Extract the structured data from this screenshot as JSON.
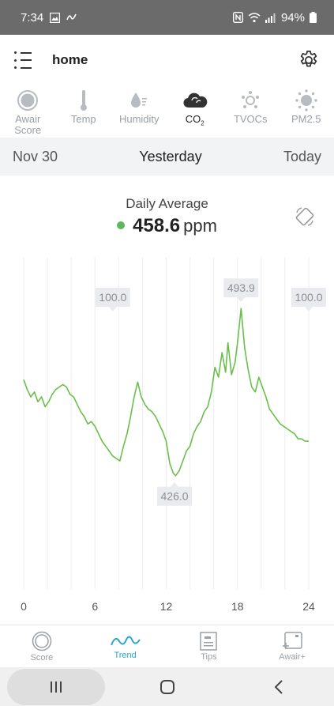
{
  "status_bar": {
    "time": "7:34",
    "battery": "94%"
  },
  "header": {
    "title": "home"
  },
  "sensor_tabs": [
    {
      "label": "Awair Score",
      "icon": "awair-score-icon",
      "active": false
    },
    {
      "label": "Temp",
      "icon": "thermometer-icon",
      "active": false
    },
    {
      "label": "Humidity",
      "icon": "humidity-icon",
      "active": false
    },
    {
      "label": "CO2",
      "icon": "cloud-icon",
      "active": true
    },
    {
      "label": "TVOCs",
      "icon": "tvoc-icon",
      "active": false
    },
    {
      "label": "PM2.5",
      "icon": "pm25-icon",
      "active": false
    }
  ],
  "date_nav": {
    "prev": "Nov 30",
    "current": "Yesterday",
    "next": "Today"
  },
  "summary": {
    "title": "Daily Average",
    "value": "458.6",
    "unit": "ppm",
    "status_color": "#5cb85c"
  },
  "chart_data": {
    "type": "line",
    "x_ticks": [
      "0",
      "6",
      "12",
      "18",
      "24"
    ],
    "xlim": [
      0,
      24
    ],
    "ylim": [
      380,
      510
    ],
    "line_color": "#6abf4b",
    "annotations": [
      {
        "label": "100.0",
        "x": 7.5,
        "y": 490,
        "kind": "marker-down"
      },
      {
        "label": "100.0",
        "x": 24,
        "y": 490,
        "kind": "marker-down"
      },
      {
        "label": "493.9",
        "x": 18.3,
        "y": 493.9,
        "kind": "max"
      },
      {
        "label": "426.0",
        "x": 12.7,
        "y": 426.0,
        "kind": "min"
      }
    ],
    "series": [
      {
        "values": [
          [
            0.0,
            465
          ],
          [
            0.3,
            461
          ],
          [
            0.6,
            458
          ],
          [
            0.9,
            460
          ],
          [
            1.2,
            456
          ],
          [
            1.5,
            458
          ],
          [
            1.8,
            454
          ],
          [
            2.1,
            456
          ],
          [
            2.4,
            459
          ],
          [
            2.7,
            461
          ],
          [
            3.0,
            462
          ],
          [
            3.3,
            463
          ],
          [
            3.6,
            462
          ],
          [
            3.9,
            459
          ],
          [
            4.2,
            458
          ],
          [
            4.5,
            455
          ],
          [
            4.8,
            452
          ],
          [
            5.1,
            450
          ],
          [
            5.4,
            447
          ],
          [
            5.7,
            448
          ],
          [
            6.0,
            446
          ],
          [
            6.3,
            443
          ],
          [
            6.6,
            440
          ],
          [
            6.9,
            438
          ],
          [
            7.2,
            436
          ],
          [
            7.5,
            434
          ],
          [
            7.8,
            433
          ],
          [
            8.1,
            432
          ],
          [
            8.4,
            438
          ],
          [
            8.7,
            443
          ],
          [
            9.0,
            450
          ],
          [
            9.3,
            458
          ],
          [
            9.6,
            464
          ],
          [
            9.9,
            458
          ],
          [
            10.2,
            455
          ],
          [
            10.5,
            453
          ],
          [
            10.8,
            452
          ],
          [
            11.1,
            450
          ],
          [
            11.4,
            447
          ],
          [
            11.7,
            444
          ],
          [
            12.0,
            440
          ],
          [
            12.3,
            431
          ],
          [
            12.6,
            427
          ],
          [
            12.8,
            426
          ],
          [
            13.1,
            428
          ],
          [
            13.4,
            432
          ],
          [
            13.7,
            436
          ],
          [
            14.0,
            438
          ],
          [
            14.3,
            443
          ],
          [
            14.6,
            446
          ],
          [
            14.9,
            448
          ],
          [
            15.2,
            452
          ],
          [
            15.5,
            454
          ],
          [
            15.8,
            460
          ],
          [
            16.1,
            470
          ],
          [
            16.4,
            466
          ],
          [
            16.7,
            476
          ],
          [
            17.0,
            468
          ],
          [
            17.2,
            480
          ],
          [
            17.5,
            467
          ],
          [
            17.8,
            472
          ],
          [
            18.0,
            480
          ],
          [
            18.3,
            493.9
          ],
          [
            18.6,
            478
          ],
          [
            18.9,
            469
          ],
          [
            19.2,
            462
          ],
          [
            19.5,
            460
          ],
          [
            19.8,
            466
          ],
          [
            20.1,
            462
          ],
          [
            20.4,
            458
          ],
          [
            20.7,
            453
          ],
          [
            21.0,
            451
          ],
          [
            21.3,
            449
          ],
          [
            21.6,
            447
          ],
          [
            21.9,
            446
          ],
          [
            22.2,
            445
          ],
          [
            22.5,
            444
          ],
          [
            22.8,
            443
          ],
          [
            23.1,
            441
          ],
          [
            23.4,
            441
          ],
          [
            23.7,
            440
          ],
          [
            24.0,
            440
          ]
        ]
      }
    ]
  },
  "bottom_nav": [
    {
      "label": "Score",
      "icon": "score-icon",
      "active": false
    },
    {
      "label": "Trend",
      "icon": "trend-icon",
      "active": true
    },
    {
      "label": "Tips",
      "icon": "tips-icon",
      "active": false
    },
    {
      "label": "Awair+",
      "icon": "awair-plus-icon",
      "active": false
    }
  ]
}
